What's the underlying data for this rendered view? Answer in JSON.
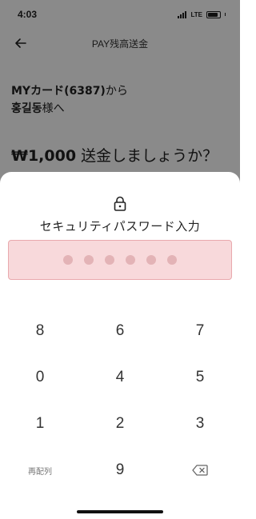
{
  "status_bar": {
    "time": "4:03",
    "network": "LTE"
  },
  "header": {
    "title": "PAY残高送金"
  },
  "transfer": {
    "from_card": "MYカード(6387)",
    "from_suffix": "から",
    "recipient": "홍길동",
    "recipient_suffix": "様へ",
    "amount": "₩1,000",
    "question": "送金しましょうか？"
  },
  "sheet": {
    "title": "セキュリティパスワード入力",
    "pin_length": 6,
    "pin_entered": 0
  },
  "keypad": {
    "rows": [
      [
        "8",
        "6",
        "7"
      ],
      [
        "0",
        "4",
        "5"
      ],
      [
        "1",
        "2",
        "3"
      ]
    ],
    "shuffle_label": "再配列",
    "last_digit": "9"
  },
  "colors": {
    "pin_box_bg": "#f8d9db",
    "pin_box_border": "#e9a9ad",
    "backdrop": "#8a8a8a"
  }
}
